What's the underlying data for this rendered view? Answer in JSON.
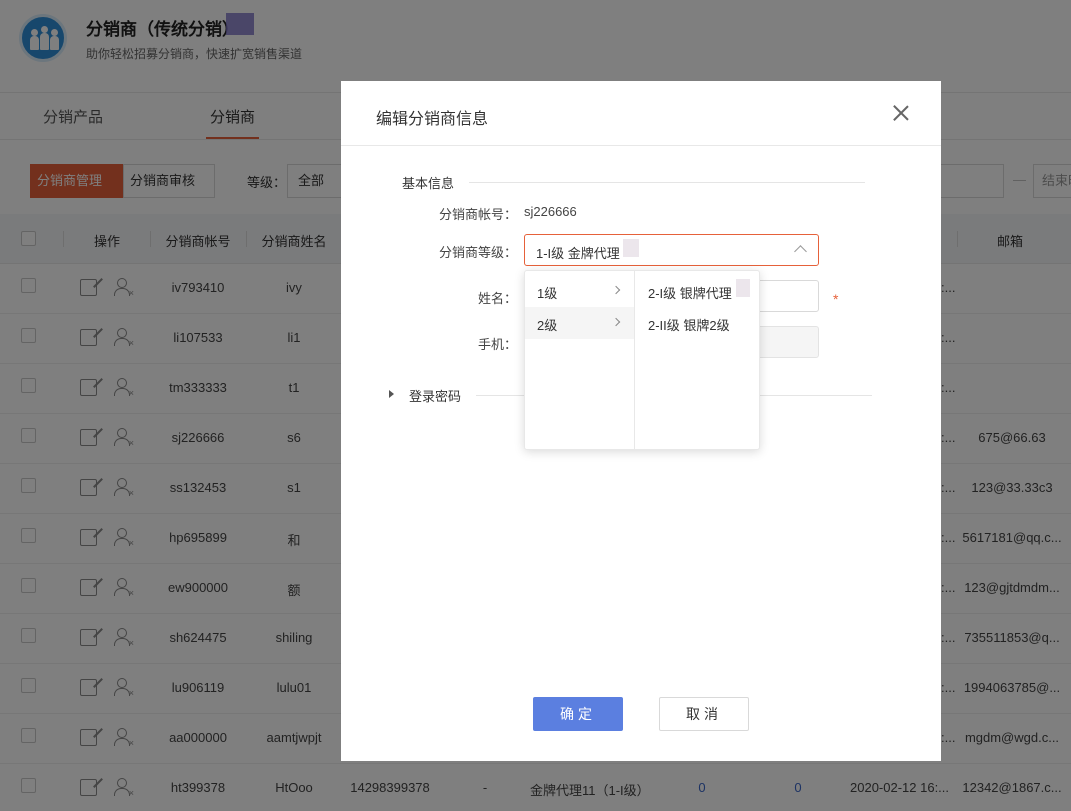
{
  "app": {
    "title": "分销商（传统分销）",
    "subtitle": "助你轻松招募分销商，快速扩宽销售渠道"
  },
  "tabs": [
    {
      "label": "分销产品"
    },
    {
      "label": "分销商"
    }
  ],
  "filters": {
    "btn_manage": "分销商管理",
    "btn_review": "分销商审核",
    "level_label": "等级：",
    "level_value": "全部",
    "date_end_placeholder": "结束时",
    "date_dash": "—"
  },
  "table": {
    "headers": {
      "action": "操作",
      "account": "分销商帐号",
      "name": "分销商姓名",
      "email": "邮箱"
    },
    "rows": [
      {
        "account": "iv793410",
        "name": "ivy",
        "date": ":...",
        "email": ""
      },
      {
        "account": "li107533",
        "name": "li1",
        "date": ":...",
        "email": ""
      },
      {
        "account": "tm333333",
        "name": "t1",
        "date": ":...",
        "email": ""
      },
      {
        "account": "sj226666",
        "name": "s6",
        "date": ":...",
        "email": "675@66.63"
      },
      {
        "account": "ss132453",
        "name": "s1",
        "date": ":...",
        "email": "123@33.33c3"
      },
      {
        "account": "hp695899",
        "name": "和",
        "date": ":...",
        "email": "5617181@qq.c..."
      },
      {
        "account": "ew900000",
        "name": "额",
        "date": ":...",
        "email": "123@gjtdmdm..."
      },
      {
        "account": "sh624475",
        "name": "shiling",
        "date": ":...",
        "email": "735511853@q..."
      },
      {
        "account": "lu906119",
        "name": "lulu01",
        "date": ":...",
        "email": "1994063785@..."
      },
      {
        "account": "aa000000",
        "name": "aamtjwpjt",
        "date": ":...",
        "email": "mgdm@wgd.c..."
      },
      {
        "account": "ht399378",
        "name": "HtOoo",
        "phone": "14298399378",
        "dash": "-",
        "level": "金牌代理11（1-I级）",
        "n1": "0",
        "n2": "0",
        "date": "2020-02-12 16:...",
        "email": "12342@1867.c..."
      }
    ]
  },
  "modal": {
    "title": "编辑分销商信息",
    "section_basic": "基本信息",
    "account_label": "分销商帐号：",
    "account_value": "sj226666",
    "level_label": "分销商等级：",
    "level_value": "1-I级 金牌代理",
    "name_label": "姓名：",
    "phone_label": "手机：",
    "required_mark": "*",
    "password_section": "登录密码",
    "ok": "确定",
    "cancel": "取消",
    "cascader": {
      "level1": [
        {
          "label": "1级"
        },
        {
          "label": "2级"
        }
      ],
      "level2": [
        {
          "label": "2-I级 银牌代理"
        },
        {
          "label": "2-II级 银牌2级"
        }
      ]
    }
  },
  "colors": {
    "accent": "#e6613a",
    "primary_button": "#5b7fe0",
    "link_number": "#3a66c8"
  }
}
